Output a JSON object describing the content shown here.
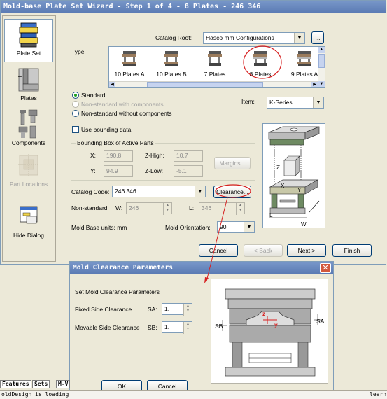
{
  "wizard": {
    "title": "Mold-base Plate Set Wizard - Step 1 of 4  - 8 Plates - 246 346",
    "nav": [
      {
        "label": "Plate Set",
        "selected": true
      },
      {
        "label": "Plates"
      },
      {
        "label": "Components"
      },
      {
        "label": "Part Locations",
        "disabled": true
      },
      {
        "label": "Hide Dialog"
      }
    ],
    "catalog_root_label": "Catalog Root:",
    "catalog_root_value": "Hasco mm Configurations",
    "browse_label": "...",
    "type_label": "Type:",
    "types": [
      "10 Plates A",
      "10 Plates B",
      "7 Plates",
      "8 Plates",
      "9 Plates A"
    ],
    "radio_standard": "Standard",
    "radio_nonstd_with": "Non-standard with components",
    "radio_nonstd_without": "Non-standard without components",
    "item_label": "Item:",
    "item_value": "K-Series",
    "use_bounding": "Use bounding data",
    "bbox_title": "Bounding Box of Active Parts",
    "x_label": "X:",
    "x_value": "190.8",
    "y_label": "Y:",
    "y_value": "94.9",
    "zhigh_label": "Z-High:",
    "zhigh_value": "10.7",
    "zlow_label": "Z-Low:",
    "zlow_value": "-5.1",
    "margins_label": "Margins...",
    "catalog_code_label": "Catalog Code:",
    "catalog_code_value": "246 346",
    "clearance_label": "Clearance...",
    "nonstandard_label": "Non-standard",
    "w_label": "W:",
    "w_value": "246",
    "l_label": "L:",
    "l_value": "346",
    "units_label": "Mold Base units: mm",
    "orientation_label": "Mold Orientation:",
    "orientation_value": "90",
    "cancel": "Cancel",
    "back": "< Back",
    "next": "Next >",
    "finish": "Finish",
    "diagram_labels": {
      "z": "Z",
      "x": "X",
      "y": "Y",
      "l": "L",
      "w": "W"
    }
  },
  "clearance_dialog": {
    "title": "Mold Clearance Parameters",
    "heading": "Set Mold Clearance Parameters",
    "fixed_label": "Fixed Side Clearance",
    "sa_label": "SA:",
    "sa_value": "1.",
    "movable_label": "Movable Side Clearance",
    "sb_label": "SB:",
    "sb_value": "1.",
    "ok": "OK",
    "cancel": "Cancel",
    "diagram_labels": {
      "sb": "SB",
      "sa": "SA",
      "z": "z",
      "y": "y"
    }
  },
  "bottom": {
    "tab_features": "Features",
    "tab_sets": "Sets",
    "tab_m": "M-V",
    "status_left": "oldDesign is loading",
    "status_right": "learn"
  },
  "colors": {
    "title_blue": "#5a7ab3",
    "highlight_red": "#d62020",
    "close_red": "#d2583c"
  }
}
